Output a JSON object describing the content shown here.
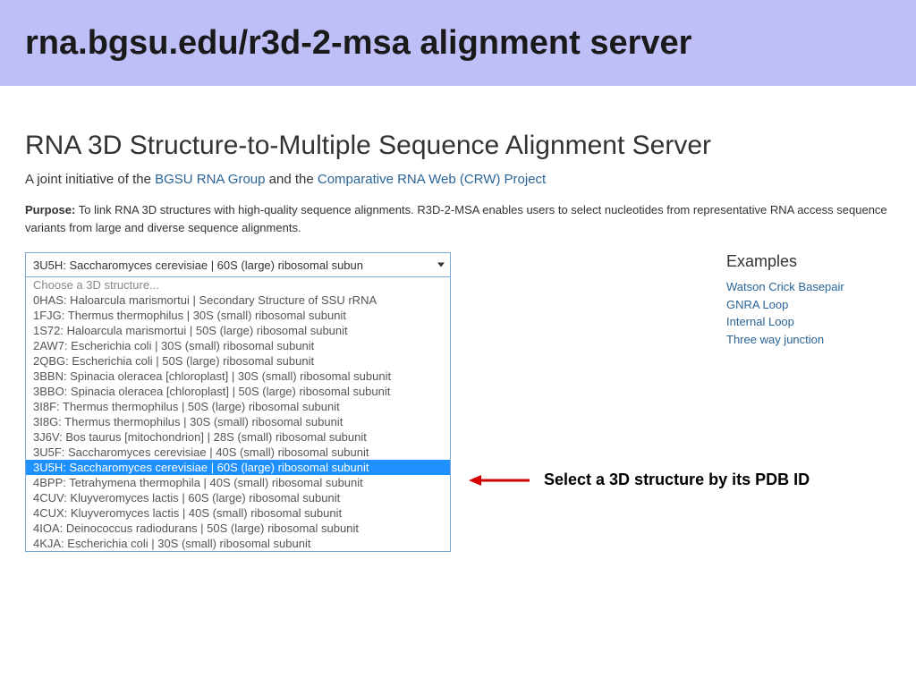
{
  "banner": {
    "text": "rna.bgsu.edu/r3d-2-msa alignment server"
  },
  "header": {
    "title": "RNA 3D Structure-to-Multiple Sequence Alignment Server",
    "subtitle_prefix": "A joint initiative of the ",
    "link1": "BGSU RNA Group",
    "subtitle_middle": " and the ",
    "link2": "Comparative RNA Web (CRW) Project"
  },
  "purpose": {
    "label": "Purpose:",
    "text": " To link RNA 3D structures with high-quality sequence alignments. R3D-2-MSA enables users to select nucleotides from representative RNA access sequence variants from large and diverse sequence alignments."
  },
  "select": {
    "current": "3U5H: Saccharomyces cerevisiae | 60S (large) ribosomal subun",
    "placeholder": "Choose a 3D structure...",
    "options": [
      "0HAS: Haloarcula marismortui | Secondary Structure of SSU rRNA",
      "1FJG: Thermus thermophilus | 30S (small) ribosomal subunit",
      "1S72: Haloarcula marismortui | 50S (large) ribosomal subunit",
      "2AW7: Escherichia coli | 30S (small) ribosomal subunit",
      "2QBG: Escherichia coli | 50S (large) ribosomal subunit",
      "3BBN: Spinacia oleracea [chloroplast] | 30S (small) ribosomal subunit",
      "3BBO: Spinacia oleracea [chloroplast] | 50S (large) ribosomal subunit",
      "3I8F: Thermus thermophilus | 50S (large) ribosomal subunit",
      "3I8G: Thermus thermophilus | 30S (small) ribosomal subunit",
      "3J6V: Bos taurus [mitochondrion] | 28S (small) ribosomal subunit",
      "3U5F: Saccharomyces cerevisiae | 40S (small) ribosomal subunit",
      "3U5H: Saccharomyces cerevisiae | 60S (large) ribosomal subunit",
      "4BPP: Tetrahymena thermophila | 40S (small) ribosomal subunit",
      "4CUV: Kluyveromyces lactis | 60S (large) ribosomal subunit",
      "4CUX: Kluyveromyces lactis | 40S (small) ribosomal subunit",
      "4IOA: Deinococcus radiodurans | 50S (large) ribosomal subunit",
      "4KJA: Escherichia coli | 30S (small) ribosomal subunit"
    ],
    "selected_index": 11
  },
  "examples": {
    "heading": "Examples",
    "items": [
      "Watson Crick Basepair",
      "GNRA Loop",
      "Internal Loop",
      "Three way junction"
    ]
  },
  "annotation": {
    "text": "Select a 3D structure by its PDB ID"
  }
}
